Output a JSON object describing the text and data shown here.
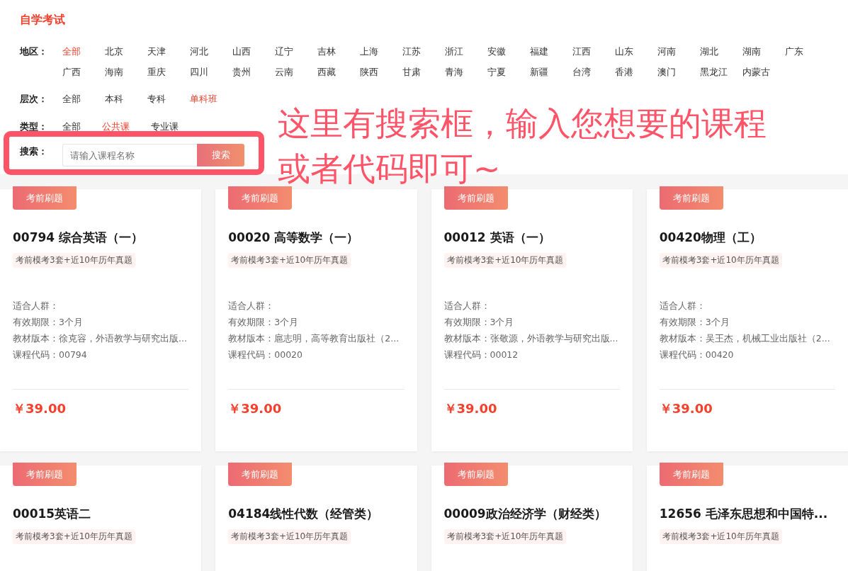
{
  "page_title": "自学考试",
  "filters": [
    {
      "label": "地区：",
      "options": [
        {
          "label": "全部",
          "selected": true
        },
        {
          "label": "北京",
          "selected": false
        },
        {
          "label": "天津",
          "selected": false
        },
        {
          "label": "河北",
          "selected": false
        },
        {
          "label": "山西",
          "selected": false
        },
        {
          "label": "辽宁",
          "selected": false
        },
        {
          "label": "吉林",
          "selected": false
        },
        {
          "label": "上海",
          "selected": false
        },
        {
          "label": "江苏",
          "selected": false
        },
        {
          "label": "浙江",
          "selected": false
        },
        {
          "label": "安徽",
          "selected": false
        },
        {
          "label": "福建",
          "selected": false
        },
        {
          "label": "江西",
          "selected": false
        },
        {
          "label": "山东",
          "selected": false
        },
        {
          "label": "河南",
          "selected": false
        },
        {
          "label": "湖北",
          "selected": false
        },
        {
          "label": "湖南",
          "selected": false
        },
        {
          "label": "广东",
          "selected": false
        },
        {
          "label": "广西",
          "selected": false
        },
        {
          "label": "海南",
          "selected": false
        },
        {
          "label": "重庆",
          "selected": false
        },
        {
          "label": "四川",
          "selected": false
        },
        {
          "label": "贵州",
          "selected": false
        },
        {
          "label": "云南",
          "selected": false
        },
        {
          "label": "西藏",
          "selected": false
        },
        {
          "label": "陕西",
          "selected": false
        },
        {
          "label": "甘肃",
          "selected": false
        },
        {
          "label": "青海",
          "selected": false
        },
        {
          "label": "宁夏",
          "selected": false
        },
        {
          "label": "新疆",
          "selected": false
        },
        {
          "label": "台湾",
          "selected": false
        },
        {
          "label": "香港",
          "selected": false
        },
        {
          "label": "澳门",
          "selected": false
        },
        {
          "label": "黑龙江",
          "selected": false
        },
        {
          "label": "内蒙古",
          "selected": false
        }
      ]
    },
    {
      "label": "层次：",
      "options": [
        {
          "label": "全部",
          "selected": false
        },
        {
          "label": "本科",
          "selected": false
        },
        {
          "label": "专科",
          "selected": false
        },
        {
          "label": "单科班",
          "selected": true
        }
      ]
    },
    {
      "label": "类型：",
      "options": [
        {
          "label": "全部",
          "selected": false
        },
        {
          "label": "公共课",
          "selected": true
        },
        {
          "label": "专业课",
          "selected": false
        }
      ]
    }
  ],
  "search": {
    "label": "搜索：",
    "placeholder": "请输入课程名称",
    "button": "搜索"
  },
  "annotation_lines": [
    "这里有搜索框，输入您想要的课程",
    "或者代码即可~"
  ],
  "courses": [
    {
      "tag": "考前刷题",
      "title": "00794 综合英语（一）",
      "subtitle": "考前模考3套+近10年历年真题",
      "details": [
        "适合人群：",
        "有效期限：3个月",
        "教材版本：徐克容，外语教学与研究出版...",
        "课程代码：00794"
      ],
      "price": "￥39.00"
    },
    {
      "tag": "考前刷题",
      "title": "00020 高等数学（一）",
      "subtitle": "考前模考3套+近10年历年真题",
      "details": [
        "适合人群：",
        "有效期限：3个月",
        "教材版本：扈志明，高等教育出版社（2...",
        "课程代码：00020"
      ],
      "price": "￥39.00"
    },
    {
      "tag": "考前刷题",
      "title": "00012 英语（一）",
      "subtitle": "考前模考3套+近10年历年真题",
      "details": [
        "适合人群：",
        "有效期限：3个月",
        "教材版本：张敬源，外语教学与研究出版...",
        "课程代码：00012"
      ],
      "price": "￥39.00"
    },
    {
      "tag": "考前刷题",
      "title": "00420物理（工）",
      "subtitle": "考前模考3套+近10年历年真题",
      "details": [
        "适合人群：",
        "有效期限：3个月",
        "教材版本：吴王杰，机械工业出版社（2...",
        "课程代码：00420"
      ],
      "price": "￥39.00"
    },
    {
      "tag": "考前刷题",
      "title": "00015英语二",
      "subtitle": "考前模考3套+近10年历年真题"
    },
    {
      "tag": "考前刷题",
      "title": "04184线性代数（经管类）",
      "subtitle": "考前模考3套+近10年历年真题"
    },
    {
      "tag": "考前刷题",
      "title": "00009政治经济学（财经类）",
      "subtitle": "考前模考3套+近10年历年真题"
    },
    {
      "tag": "考前刷题",
      "title": "12656 毛泽东思想和中国特...",
      "subtitle": "考前模考3套+近10年历年真题"
    }
  ]
}
